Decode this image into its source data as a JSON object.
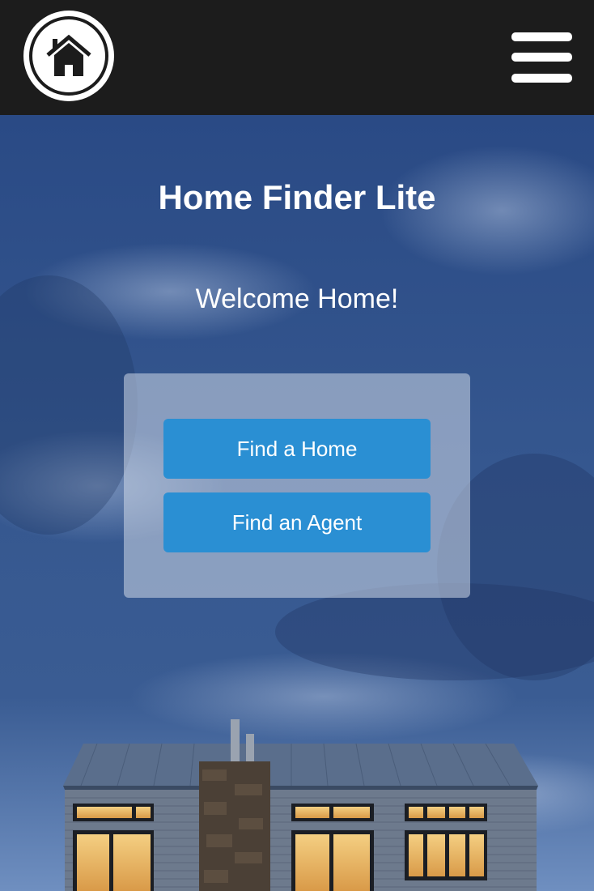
{
  "header": {
    "logo_icon": "house-icon",
    "menu_icon": "hamburger-menu-icon",
    "background_color": "#1c1c1c"
  },
  "main": {
    "title": "Home Finder Lite",
    "welcome": "Welcome Home!",
    "buttons": {
      "find_home": "Find a Home",
      "find_agent": "Find an Agent"
    },
    "button_color": "#2a8fd3"
  }
}
